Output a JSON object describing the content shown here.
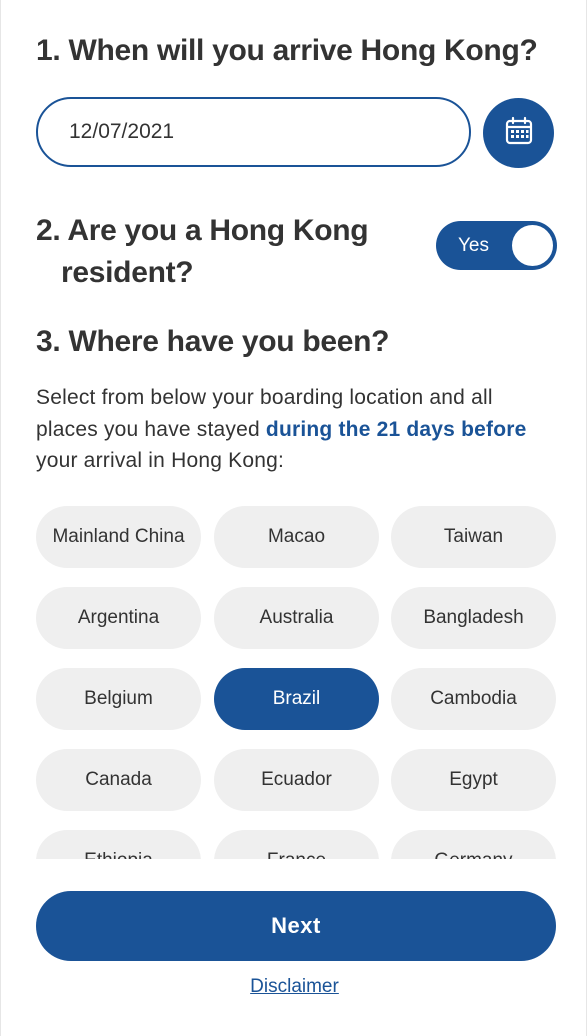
{
  "colors": {
    "primary": "#1a5397",
    "chip_bg": "#efefef",
    "text": "#333333"
  },
  "q1": {
    "title": "1. When will you arrive Hong Kong?",
    "date_value": "12/07/2021",
    "calendar_icon": "calendar-icon"
  },
  "q2": {
    "title_line1": "2. Are you a Hong Kong",
    "title_line2": "resident?",
    "toggle_label": "Yes",
    "toggle_on": true
  },
  "q3": {
    "title": "3. Where have you been?",
    "desc_part1": "Select from below your boarding location and all places you have stayed ",
    "desc_highlight": "during the 21 days before",
    "desc_part2": " your arrival in Hong Kong:",
    "locations": [
      {
        "label": "Mainland China",
        "selected": false
      },
      {
        "label": "Macao",
        "selected": false
      },
      {
        "label": "Taiwan",
        "selected": false
      },
      {
        "label": "Argentina",
        "selected": false
      },
      {
        "label": "Australia",
        "selected": false
      },
      {
        "label": "Bangladesh",
        "selected": false
      },
      {
        "label": "Belgium",
        "selected": false
      },
      {
        "label": "Brazil",
        "selected": true
      },
      {
        "label": "Cambodia",
        "selected": false
      },
      {
        "label": "Canada",
        "selected": false
      },
      {
        "label": "Ecuador",
        "selected": false
      },
      {
        "label": "Egypt",
        "selected": false
      },
      {
        "label": "Ethiopia",
        "selected": false
      },
      {
        "label": "France",
        "selected": false
      },
      {
        "label": "Germany",
        "selected": false
      }
    ]
  },
  "footer": {
    "next_label": "Next",
    "disclaimer_label": "Disclaimer"
  }
}
